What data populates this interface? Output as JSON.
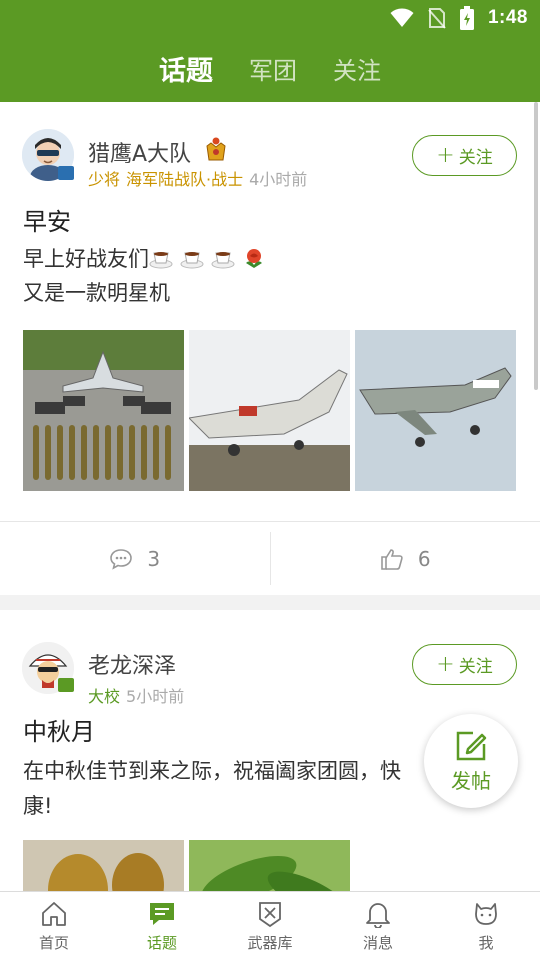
{
  "status_bar": {
    "time": "1:48"
  },
  "top_tabs": [
    {
      "label": "话题",
      "active": true
    },
    {
      "label": "军团",
      "active": false
    },
    {
      "label": "关注",
      "active": false
    }
  ],
  "posts": [
    {
      "author": "猎鹰A大队",
      "rank": "少将",
      "unit": "海军陆战队·战士",
      "time": "4小时前",
      "follow_label": "关注",
      "title": "早安",
      "body_line1": "早上好战友们",
      "body_line2": "又是一款明星机",
      "emojis": [
        "coffee-icon",
        "coffee-icon",
        "coffee-icon",
        "rose-icon"
      ],
      "comments": "3",
      "likes": "6"
    },
    {
      "author": "老龙深泽",
      "rank": "大校",
      "time": "5小时前",
      "follow_label": "关注",
      "title": "中秋月",
      "body_line1": "在中秋佳节到来之际，祝福阖家团圆，快",
      "body_line2": "康!"
    }
  ],
  "fab": {
    "label": "发帖"
  },
  "bottom_nav": [
    {
      "label": "首页",
      "icon": "home-icon",
      "active": false
    },
    {
      "label": "话题",
      "icon": "topic-icon",
      "active": true
    },
    {
      "label": "武器库",
      "icon": "arsenal-icon",
      "active": false
    },
    {
      "label": "消息",
      "icon": "bell-icon",
      "active": false
    },
    {
      "label": "我",
      "icon": "profile-icon",
      "active": false
    }
  ],
  "colors": {
    "brand": "#5b9a24",
    "rank_gold": "#c99300",
    "meta_gray": "#aaaaaa"
  }
}
